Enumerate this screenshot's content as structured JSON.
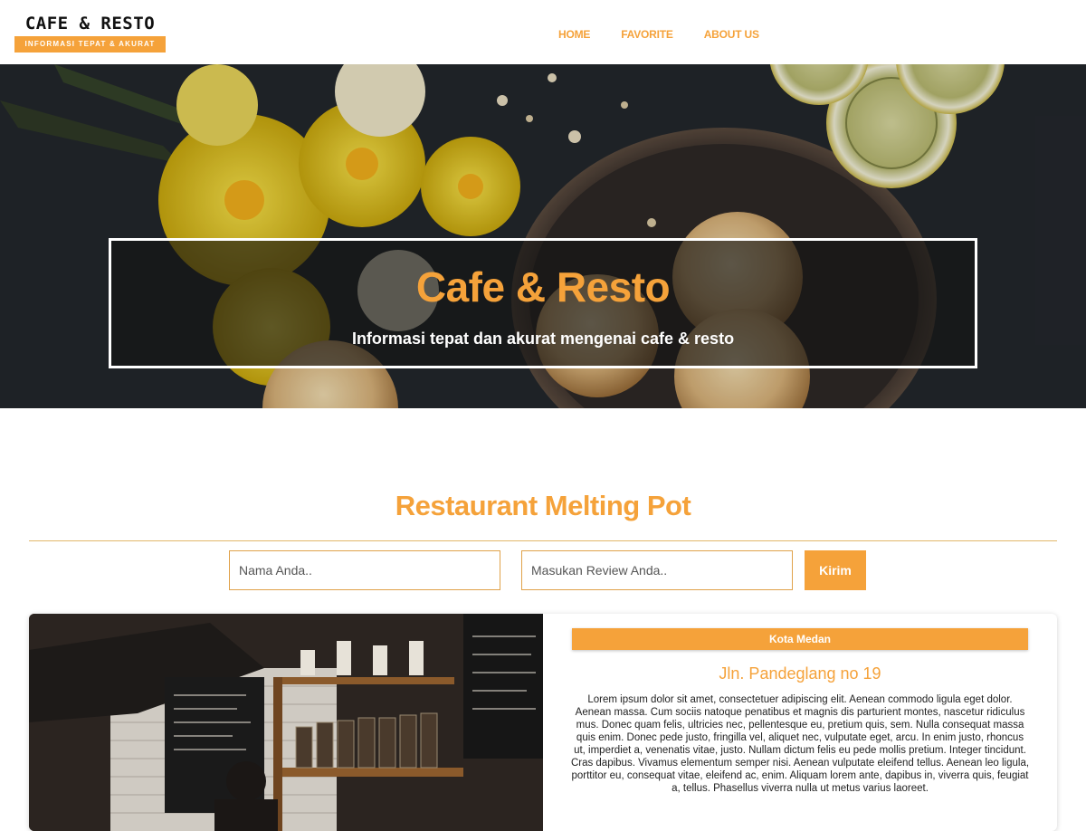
{
  "header": {
    "logo_title": "CAFE & RESTO",
    "logo_tagline": "INFORMASI TEPAT & AKURAT",
    "nav": [
      {
        "label": "HOME"
      },
      {
        "label": "FAVORITE"
      },
      {
        "label": "ABOUT US"
      }
    ]
  },
  "hero": {
    "title": "Cafe & Resto",
    "subtitle": "Informasi tepat dan akurat mengenai cafe & resto",
    "image_icon": "food-flowers-photo"
  },
  "section": {
    "title": "Restaurant Melting Pot"
  },
  "review_form": {
    "name_placeholder": "Nama Anda..",
    "review_placeholder": "Masukan Review Anda..",
    "submit_label": "Kirim"
  },
  "restaurant_card": {
    "city_badge": "Kota Medan",
    "address": "Jln. Pandeglang no 19",
    "description": "Lorem ipsum dolor sit amet, consectetuer adipiscing elit. Aenean commodo ligula eget dolor. Aenean massa. Cum sociis natoque penatibus et magnis dis parturient montes, nascetur ridiculus mus. Donec quam felis, ultricies nec, pellentesque eu, pretium quis, sem. Nulla consequat massa quis enim. Donec pede justo, fringilla vel, aliquet nec, vulputate eget, arcu. In enim justo, rhoncus ut, imperdiet a, venenatis vitae, justo. Nullam dictum felis eu pede mollis pretium. Integer tincidunt. Cras dapibus. Vivamus elementum semper nisi. Aenean vulputate eleifend tellus. Aenean leo ligula, porttitor eu, consequat vitae, eleifend ac, enim. Aliquam lorem ante, dapibus in, viverra quis, feugiat a, tellus. Phasellus viverra nulla ut metus varius laoreet.",
    "image_icon": "cafe-interior-photo"
  },
  "colors": {
    "accent": "#f5a23a",
    "hero_bg": "#22262b",
    "text_dark": "#222222"
  }
}
